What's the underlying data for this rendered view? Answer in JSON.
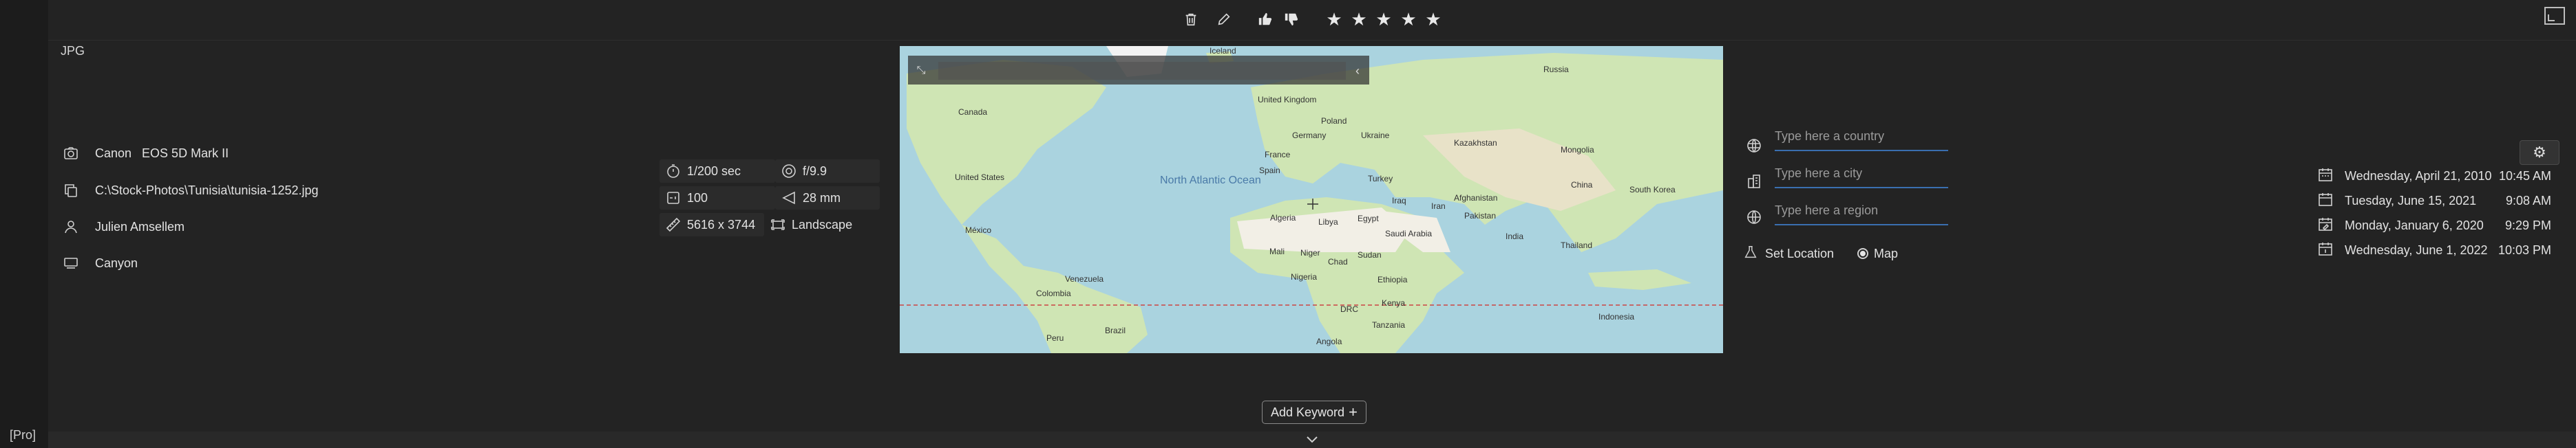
{
  "app": {
    "pro_label": "[Pro]",
    "format": "JPG"
  },
  "toolbar": {
    "icons": [
      "trash-icon",
      "pencil-icon",
      "thumbs-up-icon",
      "thumbs-down-icon"
    ],
    "rating_stars": 5
  },
  "info": {
    "camera": "Canon   EOS 5D Mark II",
    "path": "C:\\Stock-Photos\\Tunisia\\tunisia-1252.jpg",
    "author": "Julien Amsellem",
    "title": "Canyon"
  },
  "exif": {
    "shutter": "1/200 sec",
    "aperture": "f/9.9",
    "iso": "100",
    "focal": "28 mm",
    "dimensions": "5616 x 3744",
    "orientation": "Landscape"
  },
  "map": {
    "labels": {
      "iceland": "Iceland",
      "russia": "Russia",
      "canada": "Canada",
      "uk": "United Kingdom",
      "poland": "Poland",
      "germany": "Germany",
      "ukraine": "Ukraine",
      "kazakhstan": "Kazakhstan",
      "mongolia": "Mongolia",
      "france": "France",
      "spain": "Spain",
      "turkey": "Turkey",
      "north_atlantic": "North Atlantic Ocean",
      "us": "United States",
      "iraq": "Iraq",
      "iran": "Iran",
      "afghanistan": "Afghanistan",
      "pakistan": "Pakistan",
      "china": "China",
      "south_korea": "South Korea",
      "algeria": "Algeria",
      "libya": "Libya",
      "egypt": "Egypt",
      "mexico": "México",
      "saudi": "Saudi Arabia",
      "india": "India",
      "mali": "Mali",
      "niger": "Niger",
      "chad": "Chad",
      "sudan": "Sudan",
      "thailand": "Thailand",
      "venezuela": "Venezuela",
      "colombia": "Colombia",
      "nigeria": "Nigeria",
      "ethiopia": "Ethiopia",
      "kenya": "Kenya",
      "drc": "DRC",
      "tanzania": "Tanzania",
      "indonesia": "Indonesia",
      "peru": "Peru",
      "brazil": "Brazil",
      "angola": "Angola"
    }
  },
  "location": {
    "country_placeholder": "Type here a country",
    "city_placeholder": "Type here a city",
    "region_placeholder": "Type here a region",
    "set_location_label": "Set Location",
    "map_label": "Map"
  },
  "dates": [
    {
      "date": "Wednesday, April 21, 2010",
      "time": "10:45 AM"
    },
    {
      "date": "Tuesday, June 15, 2021",
      "time": "9:08 AM"
    },
    {
      "date": "Monday, January 6, 2020",
      "time": "9:29 PM"
    },
    {
      "date": "Wednesday, June 1, 2022",
      "time": "10:03 PM"
    }
  ],
  "keywords": {
    "add_label": "Add Keyword"
  },
  "colors": {
    "water": "#aad3df",
    "land": "#cfe5b4",
    "desert": "#f2efe6",
    "accent": "#3a6fb0"
  }
}
